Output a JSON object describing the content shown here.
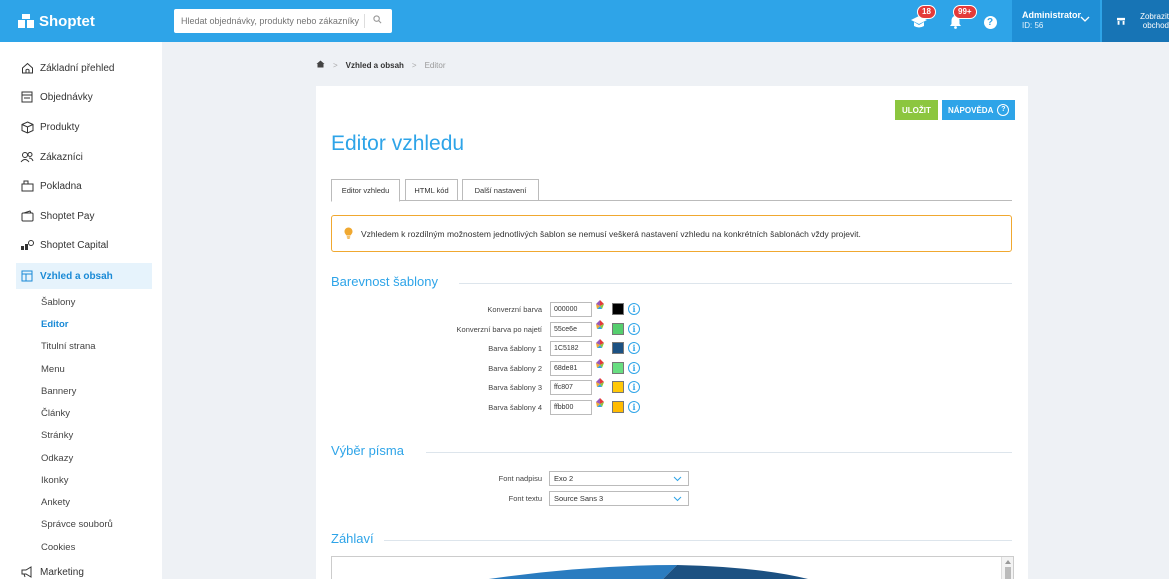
{
  "brand": {
    "name": "Shoptet"
  },
  "search": {
    "placeholder": "Hledat objednávky, produkty nebo zákazníky"
  },
  "topbar": {
    "notifications_badge": "18",
    "alerts_badge": "99+",
    "admin_name": "Administrator",
    "admin_id": "ID: 56",
    "shop_button": "Zobrazit obchod"
  },
  "sidebar": {
    "items": [
      {
        "label": "Základní přehled",
        "icon": "home-icon"
      },
      {
        "label": "Objednávky",
        "icon": "orders-icon"
      },
      {
        "label": "Produkty",
        "icon": "box-icon"
      },
      {
        "label": "Zákazníci",
        "icon": "users-icon"
      },
      {
        "label": "Pokladna",
        "icon": "cash-register-icon"
      },
      {
        "label": "Shoptet Pay",
        "icon": "wallet-icon"
      },
      {
        "label": "Shoptet Capital",
        "icon": "capital-icon"
      },
      {
        "label": "Vzhled a obsah",
        "icon": "layout-icon"
      }
    ],
    "subitems": [
      "Šablony",
      "Editor",
      "Titulní strana",
      "Menu",
      "Bannery",
      "Články",
      "Stránky",
      "Odkazy",
      "Ikonky",
      "Ankety",
      "Správce souborů",
      "Cookies"
    ],
    "marketing": {
      "label": "Marketing",
      "icon": "megaphone-icon"
    }
  },
  "breadcrumb": {
    "parent": "Vzhled a obsah",
    "current": "Editor"
  },
  "page": {
    "save_label": "ULOŽIT",
    "help_label": "NÁPOVĚDA",
    "title": "Editor vzhledu",
    "tabs": [
      "Editor vzhledu",
      "HTML kód",
      "Další nastavení"
    ],
    "alert": "Vzhledem k rozdílným možnostem jednotlivých šablon se nemusí veškerá nastavení vzhledu na konkrétních šablonách vždy projevit."
  },
  "colors_section": {
    "title": "Barevnost šablony",
    "rows": [
      {
        "label": "Konverzní barva",
        "value": "000000",
        "swatch": "#000000"
      },
      {
        "label": "Konverzní barva po najetí",
        "value": "55ce6e",
        "swatch": "#55ce6e"
      },
      {
        "label": "Barva šablony 1",
        "value": "1C5182",
        "swatch": "#1C5182"
      },
      {
        "label": "Barva šablony 2",
        "value": "68de81",
        "swatch": "#68de81"
      },
      {
        "label": "Barva šablony 3",
        "value": "ffc807",
        "swatch": "#ffc807"
      },
      {
        "label": "Barva šablony 4",
        "value": "ffbb00",
        "swatch": "#ffbb00"
      }
    ]
  },
  "font_section": {
    "title": "Výběr písma",
    "heading_label": "Font nadpisu",
    "heading_value": "Exo 2",
    "text_label": "Font textu",
    "text_value": "Source Sans 3"
  },
  "header_section": {
    "title": "Záhlaví"
  },
  "theme": {
    "accent": "#2ea4e8",
    "green": "#8cc63f",
    "warning": "#f0a830"
  }
}
